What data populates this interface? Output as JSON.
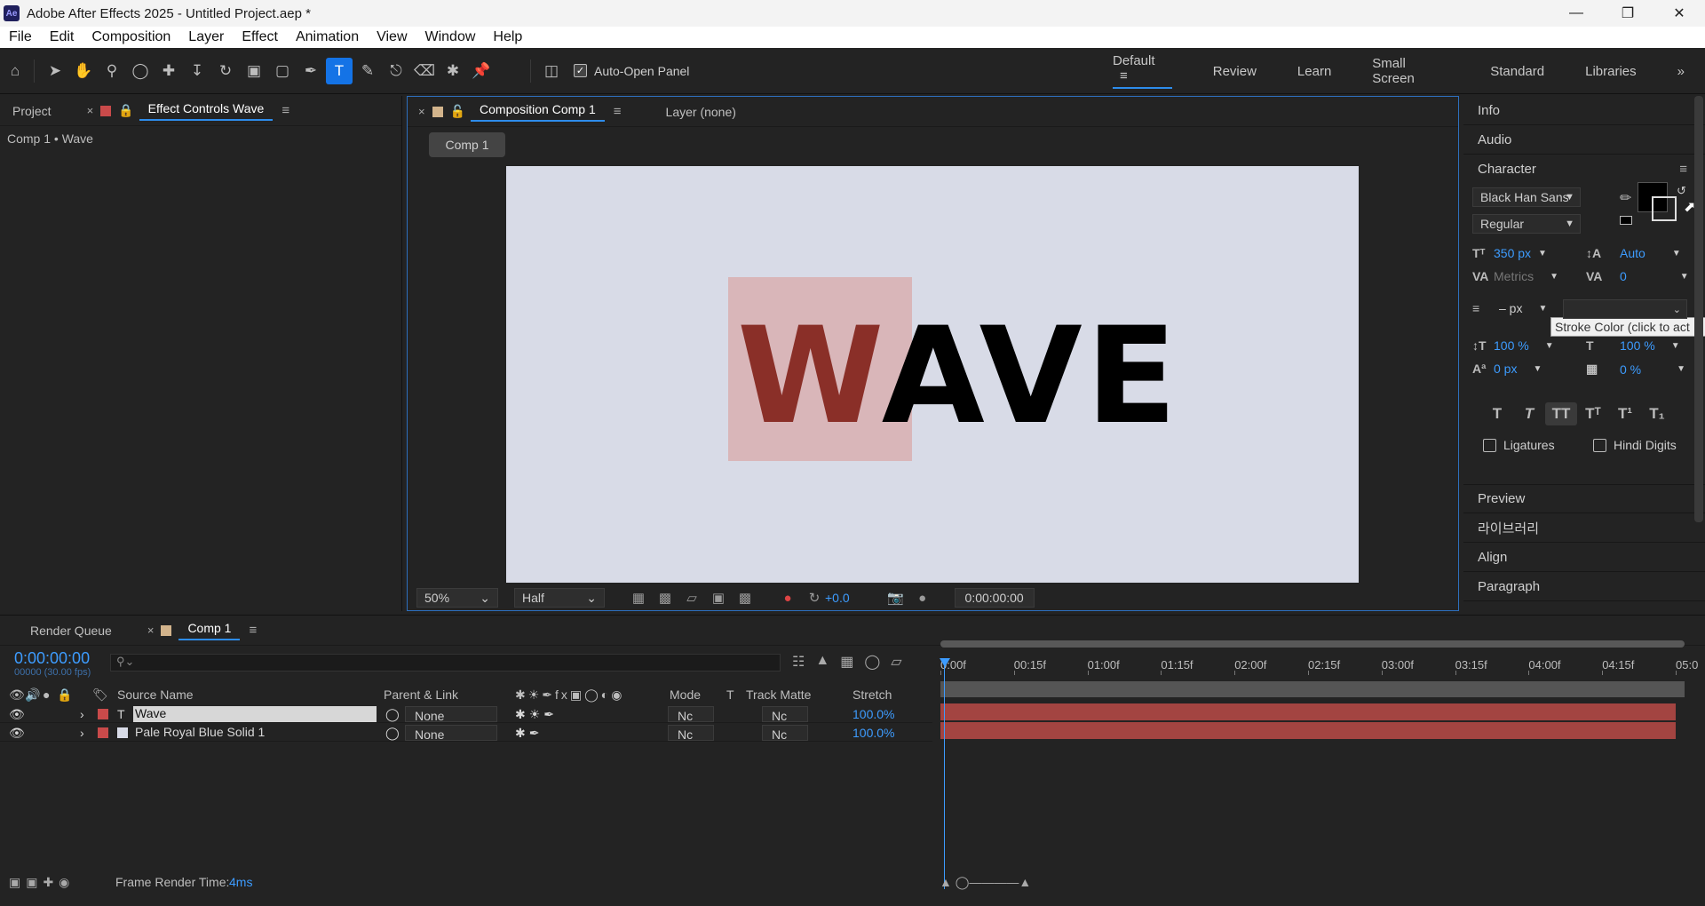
{
  "window": {
    "app_icon": "Ae",
    "title": "Adobe After Effects 2025 - Untitled Project.aep *",
    "minimize_icon": "minimize-icon",
    "maximize_icon": "restore-icon",
    "close_icon": "close-icon"
  },
  "menu": [
    "File",
    "Edit",
    "Composition",
    "Layer",
    "Effect",
    "Animation",
    "View",
    "Window",
    "Help"
  ],
  "toolbar": {
    "auto_open_label": "Auto-Open Panel",
    "auto_open_checked": true,
    "workspaces": [
      "Default",
      "Review",
      "Learn",
      "Small Screen",
      "Standard",
      "Libraries"
    ],
    "active_workspace": "Default",
    "more_icon": "chevron-double-right-icon"
  },
  "left_panel": {
    "tabs": [
      "Project",
      "Effect Controls Wave"
    ],
    "subtitle": "Comp 1 • Wave"
  },
  "comp_panel": {
    "tabs": [
      "Composition Comp 1",
      "Layer (none)"
    ],
    "comp_button": "Comp 1",
    "viewer_text": "WAVE",
    "zoom": "50%",
    "resolution": "Half",
    "exposure": "+0.0",
    "timecode": "0:00:00:00"
  },
  "right_panel": {
    "sections_top": [
      "Info",
      "Audio"
    ],
    "character_title": "Character",
    "font_family": "Black Han Sans",
    "font_style": "Regular",
    "tooltip": "Stroke Color (click to act",
    "font_size": "350 px",
    "leading": "Auto",
    "kerning": "Metrics",
    "tracking": "0",
    "stroke_width": "– px",
    "vert_scale": "100 %",
    "horiz_scale": "100 %",
    "baseline_shift": "0 px",
    "tsume": "0 %",
    "ligatures_label": "Ligatures",
    "hindi_digits_label": "Hindi Digits",
    "sections_bottom": [
      "Preview",
      "라이브러리",
      "Align",
      "Paragraph"
    ],
    "colors": {
      "fill": "#000000",
      "stroke": "#ffffff"
    }
  },
  "timeline": {
    "tabs": [
      "Render Queue",
      "Comp 1"
    ],
    "timecode": "0:00:00:00",
    "fps": "00000 (30.00 fps)",
    "search_placeholder": "",
    "columns": {
      "source_name": "Source Name",
      "parent": "Parent & Link",
      "mode": "Mode",
      "t": "T",
      "track_matte": "Track Matte",
      "stretch": "Stretch"
    },
    "layers": [
      {
        "name": "Wave",
        "type": "T",
        "parent": "None",
        "mode": "Nc",
        "matte": "Nc",
        "stretch": "100.0%",
        "label_color": "#c94a4a"
      },
      {
        "name": "Pale Royal Blue Solid 1",
        "type": "solid",
        "parent": "None",
        "mode": "Nc",
        "matte": "Nc",
        "stretch": "100.0%",
        "label_color": "#c94a4a"
      }
    ],
    "ruler": [
      "0:00f",
      "00:15f",
      "01:00f",
      "01:15f",
      "02:00f",
      "02:15f",
      "03:00f",
      "03:15f",
      "04:00f",
      "04:15f",
      "05:0"
    ],
    "status_label": "Frame Render Time:",
    "status_value": "4ms"
  }
}
